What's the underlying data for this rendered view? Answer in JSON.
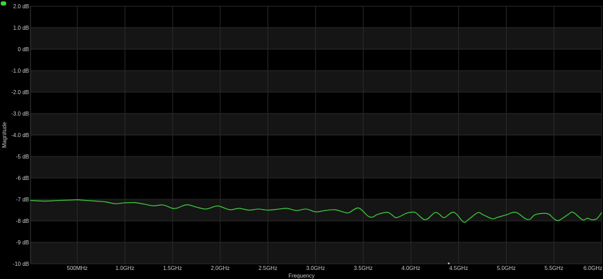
{
  "chart_data": {
    "type": "line",
    "title": "",
    "xlabel": "Frequency",
    "ylabel": "Magnitude",
    "xlim": [
      0.01,
      6.0
    ],
    "ylim": [
      -10,
      2
    ],
    "grid": true,
    "x_ticks": [
      {
        "value": 0.5,
        "label": "500MHz"
      },
      {
        "value": 1.0,
        "label": "1.0GHz"
      },
      {
        "value": 1.5,
        "label": "1.5GHz"
      },
      {
        "value": 2.0,
        "label": "2.0GHz"
      },
      {
        "value": 2.5,
        "label": "2.5GHz"
      },
      {
        "value": 3.0,
        "label": "3.0GHz"
      },
      {
        "value": 3.5,
        "label": "3.5GHz"
      },
      {
        "value": 4.0,
        "label": "4.0GHz"
      },
      {
        "value": 4.5,
        "label": "4.5GHz"
      },
      {
        "value": 5.0,
        "label": "5.0GHz"
      },
      {
        "value": 5.5,
        "label": "5.5GHz"
      },
      {
        "value": 6.0,
        "label": "6.0GHz"
      }
    ],
    "y_ticks": [
      {
        "value": 2,
        "label": "2.0 dB"
      },
      {
        "value": 1,
        "label": "1.0 dB"
      },
      {
        "value": 0,
        "label": "0 dB"
      },
      {
        "value": -1,
        "label": "-1.0 dB"
      },
      {
        "value": -2,
        "label": "-2.0 dB"
      },
      {
        "value": -3,
        "label": "-3.0 dB"
      },
      {
        "value": -4,
        "label": "-4.0 dB"
      },
      {
        "value": -5,
        "label": "-5 dB"
      },
      {
        "value": -6,
        "label": "-6 dB"
      },
      {
        "value": -7,
        "label": "-7 dB"
      },
      {
        "value": -8,
        "label": "-8 dB"
      },
      {
        "value": -9,
        "label": "-9 dB"
      },
      {
        "value": -10,
        "label": "-10 dB"
      }
    ],
    "series": [
      {
        "color": "#3ed13e",
        "x": [
          0.01,
          0.15,
          0.3,
          0.45,
          0.5,
          0.6,
          0.7,
          0.8,
          0.9,
          1.0,
          1.1,
          1.2,
          1.3,
          1.4,
          1.5,
          1.55,
          1.65,
          1.75,
          1.85,
          1.95,
          2.0,
          2.1,
          2.2,
          2.3,
          2.4,
          2.5,
          2.6,
          2.7,
          2.8,
          2.9,
          3.0,
          3.1,
          3.2,
          3.3,
          3.35,
          3.45,
          3.55,
          3.6,
          3.65,
          3.75,
          3.8,
          3.85,
          3.95,
          4.0,
          4.05,
          4.15,
          4.25,
          4.3,
          4.35,
          4.45,
          4.55,
          4.6,
          4.7,
          4.75,
          4.85,
          4.9,
          5.0,
          5.1,
          5.2,
          5.25,
          5.3,
          5.4,
          5.45,
          5.5,
          5.55,
          5.65,
          5.7,
          5.8,
          5.85,
          5.9,
          5.95,
          6.0
        ],
        "values": [
          -7.05,
          -7.08,
          -7.05,
          -7.03,
          -7.02,
          -7.05,
          -7.08,
          -7.12,
          -7.2,
          -7.16,
          -7.15,
          -7.22,
          -7.3,
          -7.26,
          -7.42,
          -7.4,
          -7.25,
          -7.36,
          -7.45,
          -7.32,
          -7.33,
          -7.48,
          -7.42,
          -7.5,
          -7.45,
          -7.5,
          -7.46,
          -7.42,
          -7.52,
          -7.45,
          -7.58,
          -7.52,
          -7.48,
          -7.6,
          -7.62,
          -7.4,
          -7.78,
          -7.82,
          -7.7,
          -7.6,
          -7.72,
          -7.85,
          -7.65,
          -7.6,
          -7.62,
          -7.95,
          -7.62,
          -7.7,
          -7.85,
          -7.6,
          -8.05,
          -7.95,
          -7.62,
          -7.7,
          -7.9,
          -7.85,
          -7.72,
          -7.6,
          -7.9,
          -7.92,
          -7.72,
          -7.65,
          -7.7,
          -7.9,
          -7.98,
          -7.7,
          -7.6,
          -7.95,
          -7.88,
          -7.95,
          -7.9,
          -7.62
        ]
      }
    ]
  }
}
